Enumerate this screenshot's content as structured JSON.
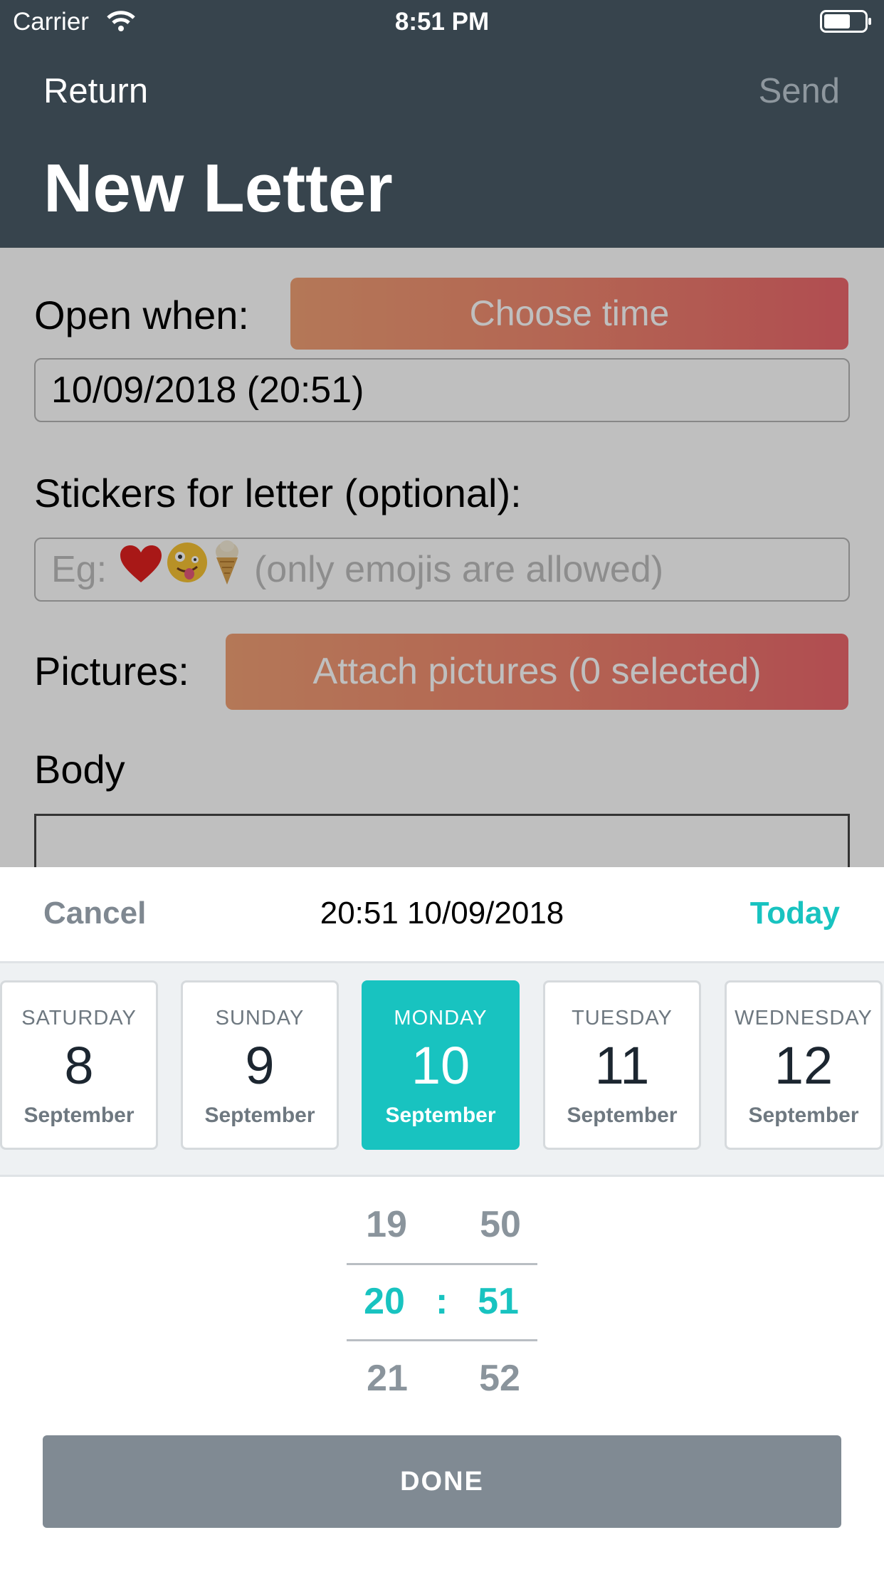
{
  "status_bar": {
    "carrier": "Carrier",
    "time": "8:51 PM"
  },
  "nav": {
    "return_label": "Return",
    "send_label": "Send",
    "title": "New Letter"
  },
  "form": {
    "open_when_label": "Open when:",
    "choose_time_label": "Choose time",
    "date_value": "10/09/2018 (20:51)",
    "stickers_label": "Stickers for letter (optional):",
    "stickers_placeholder_prefix": "Eg:",
    "stickers_placeholder_suffix": "(only emojis are allowed)",
    "stickers_example_icons": [
      "heart-emoji",
      "zany-face-emoji",
      "ice-cream-emoji"
    ],
    "pictures_label": "Pictures:",
    "attach_label": "Attach pictures (0 selected)",
    "body_label": "Body"
  },
  "picker": {
    "cancel_label": "Cancel",
    "current": "20:51 10/09/2018",
    "today_label": "Today",
    "days": [
      {
        "weekday": "SATURDAY",
        "day": "8",
        "month": "September",
        "selected": false
      },
      {
        "weekday": "SUNDAY",
        "day": "9",
        "month": "September",
        "selected": false
      },
      {
        "weekday": "MONDAY",
        "day": "10",
        "month": "September",
        "selected": true
      },
      {
        "weekday": "TUESDAY",
        "day": "11",
        "month": "September",
        "selected": false
      },
      {
        "weekday": "WEDNESDAY",
        "day": "12",
        "month": "September",
        "selected": false
      }
    ],
    "hours": [
      "19",
      "20",
      "21"
    ],
    "minutes": [
      "50",
      "51",
      "52"
    ],
    "separator": ":",
    "done_label": "DONE"
  },
  "colors": {
    "accent": "#18c3c0",
    "navbar": "#37444d",
    "gradient_start": "#f1a075",
    "gradient_end": "#ec676c",
    "done_button": "#808a93"
  }
}
